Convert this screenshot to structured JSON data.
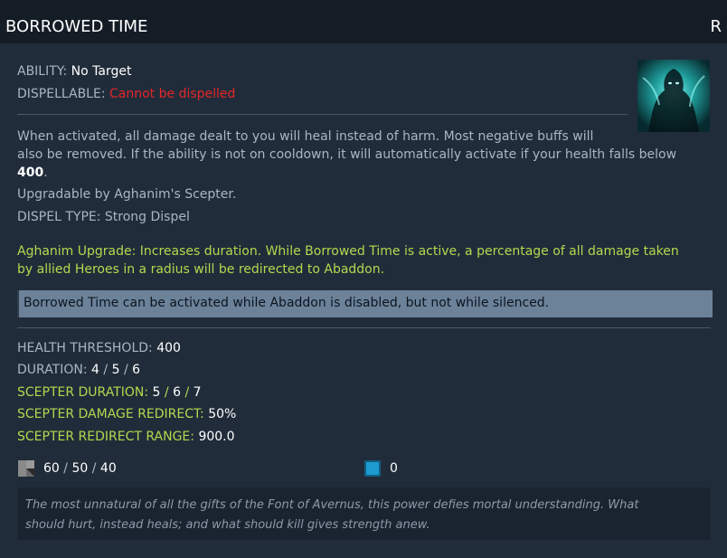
{
  "header": {
    "title": "BORROWED TIME",
    "hotkey": "R"
  },
  "ability": {
    "ability_label": "ABILITY:",
    "ability_value": "No Target",
    "dispellable_label": "DISPELLABLE:",
    "dispellable_value": "Cannot be dispelled"
  },
  "description": {
    "line_a": "When activated, all damage dealt to you will heal instead of harm. Most negative buffs will",
    "line_b": "also be removed. If the ability is not on cooldown, it will automatically activate if your health falls below",
    "threshold": "400",
    "period": ".",
    "upgradable": "Upgradable by Aghanim's Scepter.",
    "dispel_type": "DISPEL TYPE: Strong Dispel"
  },
  "aghanim": {
    "line_a": "Aghanim Upgrade: Increases duration. While Borrowed Time is active, a percentage of all damage taken",
    "line_b": "by allied Heroes in a radius will be redirected to Abaddon."
  },
  "note": "Borrowed Time can be activated while Abaddon is disabled, but not while silenced.",
  "stats": {
    "health_threshold_label": "HEALTH THRESHOLD:",
    "health_threshold_value": "400",
    "duration_label": "DURATION:",
    "duration_values": [
      "4",
      "5",
      "6"
    ],
    "scepter_duration_label": "SCEPTER DURATION:",
    "scepter_duration_values": [
      "5",
      "6",
      "7"
    ],
    "scepter_damage_redirect_label": "SCEPTER DAMAGE REDIRECT:",
    "scepter_damage_redirect_value": "50%",
    "scepter_redirect_range_label": "SCEPTER REDIRECT RANGE:",
    "scepter_redirect_range_value": "900.0",
    "separator": "/"
  },
  "costs": {
    "cooldown_icon": "cooldown-icon",
    "cooldown_values": [
      "60",
      "50",
      "40"
    ],
    "mana_icon": "mana-icon",
    "mana_value": "0",
    "mana_color": "#1e9bd0"
  },
  "lore": {
    "line_a": "The most unnatural of all the gifts of the Font of Avernus, this power defies mortal understanding. What",
    "line_b": "should hurt, instead heals; and what should kill gives strength anew."
  },
  "colors": {
    "accent_green": "#b3d94e",
    "warning_red": "#e3262a",
    "note_bg": "#6b8299"
  }
}
